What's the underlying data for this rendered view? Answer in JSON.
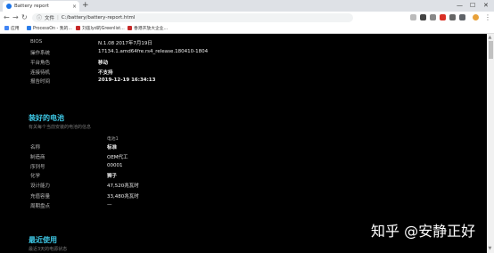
{
  "browser": {
    "tab_title": "Battery report",
    "tab_close": "×",
    "new_tab": "+",
    "win_min": "—",
    "win_max": "☐",
    "win_close": "✕",
    "address_prefix": "文件",
    "address_url": "C:/battery/battery-report.html",
    "bookmarks": [
      "应用",
      "ProcessOn - 我的...",
      "刘莲lyd的Greenlist...",
      "香港开放大企业..."
    ]
  },
  "system_info": [
    {
      "label": "BIOS",
      "value": "N.1.08 2017年7月19日",
      "bold": false
    },
    {
      "label": "操作系统",
      "value": "17134.1.amd64fre.rs4_release.180410-1804",
      "bold": false
    },
    {
      "label": "平台角色",
      "value": "移动",
      "bold": true
    },
    {
      "label": "连接待机",
      "value": "不支持",
      "bold": true
    },
    {
      "label": "报告时间",
      "value": "2019-12-19  16:34:13",
      "bold": true
    }
  ],
  "installed_batteries": {
    "title": "装好的电池",
    "subtitle": "有关每个当前安装的电池的信息",
    "column_header": "电池1",
    "rows": [
      {
        "label": "名称",
        "value": "标准",
        "bold": true
      },
      {
        "label": "制造商",
        "value": "OEM代工",
        "bold": false
      },
      {
        "label": "序列号",
        "value": "00001",
        "bold": false
      },
      {
        "label": "化学",
        "value": "狮子",
        "bold": true
      },
      {
        "label": "设计能力",
        "value": "47,520兆瓦时",
        "bold": false
      },
      {
        "label": "充值容量",
        "value": "33,480兆瓦时",
        "bold": false
      },
      {
        "label": "周期盘点",
        "value": "—",
        "bold": false
      }
    ]
  },
  "recent_usage": {
    "title": "最近使用",
    "subtitle": "最近3天的电源状态"
  },
  "watermark": "知乎 @安静正好"
}
